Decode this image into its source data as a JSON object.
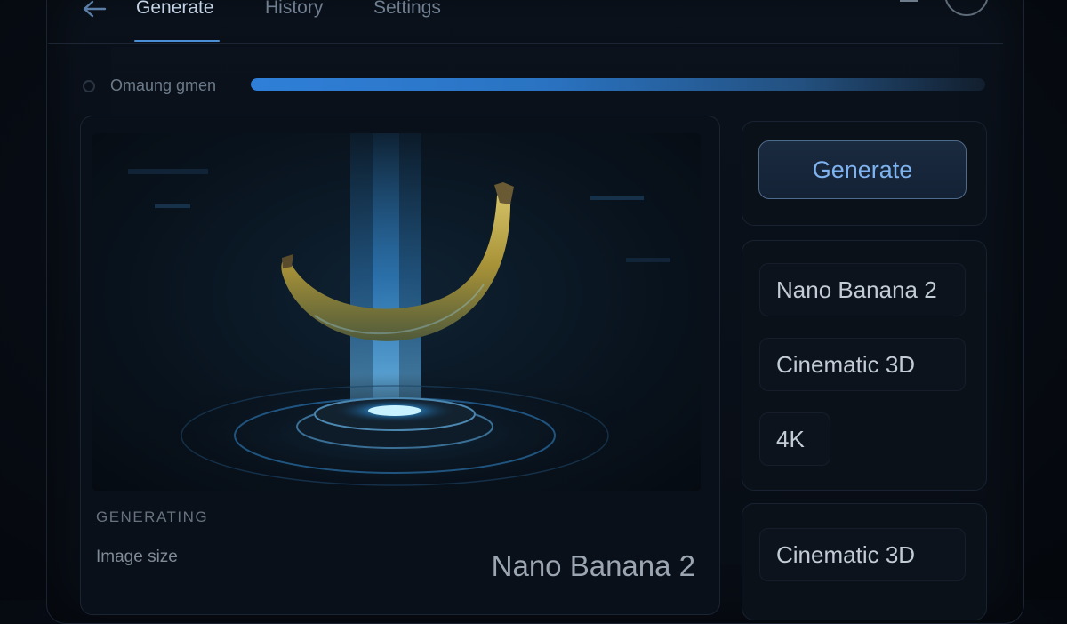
{
  "nav": {
    "tabs": [
      {
        "label": "Generate",
        "active": true
      },
      {
        "label": "History",
        "active": false
      },
      {
        "label": "Settings",
        "active": false
      }
    ]
  },
  "progress": {
    "label": "Omaung gmen",
    "percent": 100
  },
  "preview": {
    "status": "GENERATING",
    "size_label": "Image size",
    "size_value": "Nano Banana 2"
  },
  "actions": {
    "generate_label": "Generate"
  },
  "options": {
    "model": "Nano Banana 2",
    "style": "Cinematic 3D",
    "resolution": "4K"
  },
  "presets": {
    "style": "Cinematic 3D"
  },
  "colors": {
    "accent": "#4b90d6",
    "background": "#070c14"
  }
}
